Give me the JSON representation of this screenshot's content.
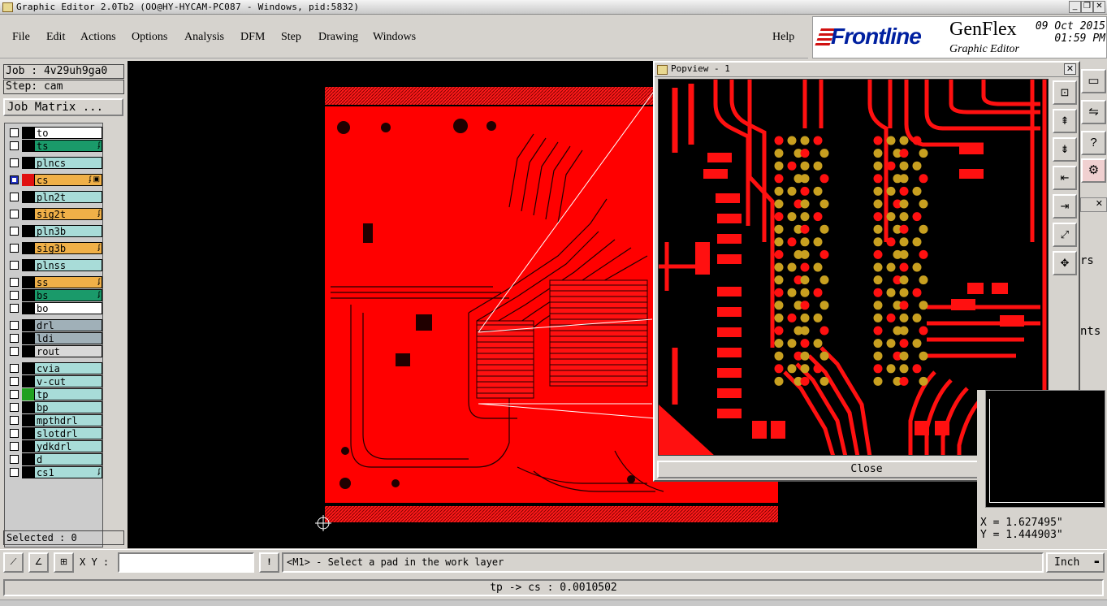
{
  "window": {
    "title": "Graphic Editor 2.0Tb2 (OO@HY-HYCAM-PC087 - Windows, pid:5832)"
  },
  "menu": {
    "file": "File",
    "edit": "Edit",
    "actions": "Actions",
    "options": "Options",
    "analysis": "Analysis",
    "dfm": "DFM",
    "step": "Step",
    "drawing": "Drawing",
    "windows": "Windows",
    "help": "Help"
  },
  "brand": {
    "company": "Frontline",
    "product": "GenFlex",
    "subtitle": "Graphic Editor",
    "date": "09 Oct 2015",
    "time": "01:59 PM"
  },
  "job": {
    "label": "Job : 4v29uh9ga0",
    "step": "Step: cam",
    "matrix_button": "Job Matrix ..."
  },
  "layers": [
    {
      "name": "to",
      "color": "#ffffff",
      "swatch": "#000000",
      "checked": false,
      "flag": ""
    },
    {
      "name": "ts",
      "color": "#1a9a6a",
      "swatch": "#000000",
      "checked": false,
      "flag": "ʄ"
    },
    {
      "name": "plncs",
      "color": "#a8dcd8",
      "swatch": "#000000",
      "checked": false,
      "flag": ""
    },
    {
      "name": "cs",
      "color": "#f0b048",
      "swatch": "#e01010",
      "checked": true,
      "flag": "ʄ ▣"
    },
    {
      "name": "pln2t",
      "color": "#a8dcd8",
      "swatch": "#000000",
      "checked": false,
      "flag": ""
    },
    {
      "name": "sig2t",
      "color": "#f0b048",
      "swatch": "#000000",
      "checked": false,
      "flag": "ʄ"
    },
    {
      "name": "pln3b",
      "color": "#a8dcd8",
      "swatch": "#000000",
      "checked": false,
      "flag": ""
    },
    {
      "name": "sig3b",
      "color": "#f0b048",
      "swatch": "#000000",
      "checked": false,
      "flag": "ʄ"
    },
    {
      "name": "plnss",
      "color": "#a8dcd8",
      "swatch": "#000000",
      "checked": false,
      "flag": ""
    },
    {
      "name": "ss",
      "color": "#f0b048",
      "swatch": "#000000",
      "checked": false,
      "flag": "ʄ"
    },
    {
      "name": "bs",
      "color": "#1a9a6a",
      "swatch": "#000000",
      "checked": false,
      "flag": "ʄ"
    },
    {
      "name": "bo",
      "color": "#ffffff",
      "swatch": "#000000",
      "checked": false,
      "flag": ""
    },
    {
      "name": "drl",
      "color": "#a0b0b8",
      "swatch": "#000000",
      "checked": false,
      "flag": ""
    },
    {
      "name": "ldi",
      "color": "#a0b0b8",
      "swatch": "#000000",
      "checked": false,
      "flag": ""
    },
    {
      "name": "rout",
      "color": "#d8d8d8",
      "swatch": "#000000",
      "checked": false,
      "flag": ""
    },
    {
      "name": "cvia",
      "color": "#a8dcd8",
      "swatch": "#000000",
      "checked": false,
      "flag": ""
    },
    {
      "name": "v-cut",
      "color": "#a8dcd8",
      "swatch": "#000000",
      "checked": false,
      "flag": ""
    },
    {
      "name": "tp",
      "color": "#a8dcd8",
      "swatch": "#20a020",
      "checked": false,
      "flag": ""
    },
    {
      "name": "bp",
      "color": "#a8dcd8",
      "swatch": "#000000",
      "checked": false,
      "flag": ""
    },
    {
      "name": "mpthdrl",
      "color": "#a8dcd8",
      "swatch": "#000000",
      "checked": false,
      "flag": ""
    },
    {
      "name": "slotdrl",
      "color": "#a8dcd8",
      "swatch": "#000000",
      "checked": false,
      "flag": ""
    },
    {
      "name": "ydkdrl",
      "color": "#a8dcd8",
      "swatch": "#000000",
      "checked": false,
      "flag": ""
    },
    {
      "name": "d",
      "color": "#a8dcd8",
      "swatch": "#000000",
      "checked": false,
      "flag": ""
    },
    {
      "name": "cs1",
      "color": "#a8dcd8",
      "swatch": "#000000",
      "checked": false,
      "flag": "ʄ"
    }
  ],
  "selected": "Selected : 0",
  "popview": {
    "title": "Popview - 1",
    "close_label": "Close"
  },
  "right_partial": {
    "item1": "rs",
    "item2": "nts"
  },
  "coords": {
    "x": "X = 1.627495\"",
    "y": "Y = 1.444903\""
  },
  "bottom": {
    "xy_label": "X Y :",
    "xy_value": "",
    "prompt": "<M1> - Select a pad in the work layer",
    "units": "Inch"
  },
  "status": {
    "text": "tp -> cs : 0.0010502"
  },
  "colors": {
    "board": "#ff0000",
    "copper": "#ff1010",
    "pad": "#c8a020",
    "background": "#000000"
  }
}
